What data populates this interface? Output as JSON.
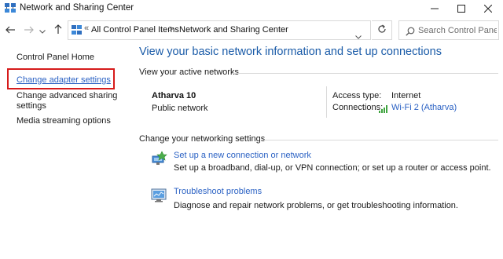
{
  "window": {
    "title": "Network and Sharing Center",
    "icon": "network-center-icon",
    "controls": [
      "minimize-icon",
      "maximize-icon",
      "close-icon"
    ]
  },
  "nav": {
    "back": "back-arrow-icon",
    "forward": "forward-arrow-icon",
    "recent": "chevron-down-icon",
    "up": "up-arrow-icon"
  },
  "address": {
    "prefix": "«",
    "crumbs": [
      "All Control Panel Items",
      "Network and Sharing Center"
    ],
    "separator": ">"
  },
  "search": {
    "placeholder": "Search Control Panel"
  },
  "sidebar": {
    "home": "Control Panel Home",
    "items": [
      {
        "label": "Change adapter settings"
      },
      {
        "label": "Change advanced sharing settings",
        "line1": "Change advanced sharing",
        "line2": "settings"
      },
      {
        "label": "Media streaming options"
      }
    ],
    "highlight_color": "#d61b1b"
  },
  "main": {
    "title": "View your basic network information and set up connections",
    "active_label": "View your active networks",
    "network": {
      "name": "Atharva 10",
      "type": "Public network",
      "access_label": "Access type:",
      "access_value": "Internet",
      "connections_label": "Connections:",
      "connections_value": "Wi-Fi 2 (Atharva)"
    },
    "settings_label": "Change your networking settings",
    "tasks": [
      {
        "icon": "new-connection-icon",
        "link": "Set up a new connection or network",
        "desc": "Set up a broadband, dial-up, or VPN connection; or set up a router or access point."
      },
      {
        "icon": "troubleshoot-icon",
        "link": "Troubleshoot problems",
        "desc": "Diagnose and repair network problems, or get troubleshooting information."
      }
    ]
  },
  "colors": {
    "link": "#2b62c4",
    "title": "#1a5ba8",
    "border": "#d9d9d9"
  }
}
